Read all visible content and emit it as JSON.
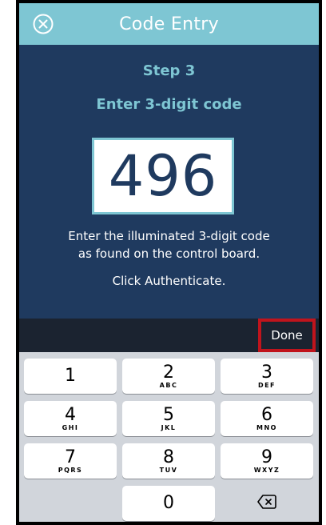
{
  "header": {
    "title": "Code Entry",
    "close_icon": "close-circle-icon"
  },
  "content": {
    "step": "Step 3",
    "subtitle": "Enter 3-digit code",
    "code_value": "496",
    "instructions_line1": "Enter the illuminated 3-digit code",
    "instructions_line2": "as found on the control board.",
    "click_auth": "Click Authenticate."
  },
  "toolbar": {
    "done_label": "Done"
  },
  "keypad": {
    "keys": [
      {
        "num": "1",
        "letters": ""
      },
      {
        "num": "2",
        "letters": "ABC"
      },
      {
        "num": "3",
        "letters": "DEF"
      },
      {
        "num": "4",
        "letters": "GHI"
      },
      {
        "num": "5",
        "letters": "JKL"
      },
      {
        "num": "6",
        "letters": "MNO"
      },
      {
        "num": "7",
        "letters": "PQRS"
      },
      {
        "num": "8",
        "letters": "TUV"
      },
      {
        "num": "9",
        "letters": "WXYZ"
      },
      {
        "num": "0",
        "letters": ""
      }
    ],
    "delete_icon": "backspace-icon"
  },
  "colors": {
    "header_bg": "#7ec6d3",
    "content_bg": "#1f3a5f",
    "accent": "#7ec6d3",
    "toolbar_bg": "#1b2330",
    "done_highlight": "#c0141c",
    "keyboard_bg": "#d1d5db"
  }
}
